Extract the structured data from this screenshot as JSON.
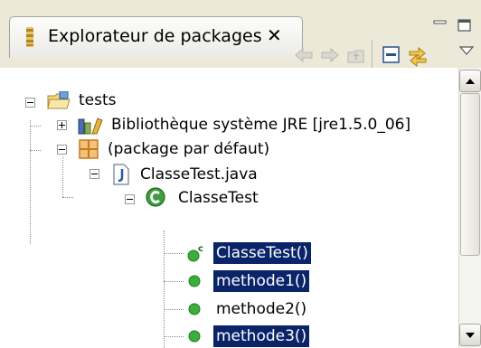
{
  "view": {
    "title": "Explorateur de packages",
    "close_glyph": "✕"
  },
  "window_controls": [
    "minimize-icon",
    "maximize-icon"
  ],
  "toolbar": {
    "icons": [
      "back-arrow-icon",
      "forward-arrow-icon",
      "up-folder-icon",
      "collapse-all-icon",
      "link-with-editor-icon",
      "view-menu-icon"
    ]
  },
  "tree": {
    "project": {
      "label": "tests",
      "icon": "project-folder-icon"
    },
    "library": {
      "label": "Bibliothèque système JRE [jre1.5.0_06]",
      "icon": "library-icon"
    },
    "package": {
      "label": "(package par défaut)",
      "icon": "package-icon"
    },
    "file": {
      "label": "ClasseTest.java",
      "icon": "java-file-icon"
    },
    "class": {
      "label": "ClasseTest",
      "icon": "class-icon"
    },
    "members": [
      {
        "label": "ClasseTest()",
        "icon": "constructor-icon",
        "selected": true
      },
      {
        "label": "methode1()",
        "icon": "public-method-icon",
        "selected": true
      },
      {
        "label": "methode2()",
        "icon": "public-method-icon",
        "selected": false
      },
      {
        "label": "methode3()",
        "icon": "public-method-icon",
        "selected": true
      }
    ]
  },
  "colors": {
    "selection": "#0a246a",
    "header_bg": "#ece9d8",
    "method_green": "#3cae3c",
    "package_orange": "#c8781e"
  }
}
